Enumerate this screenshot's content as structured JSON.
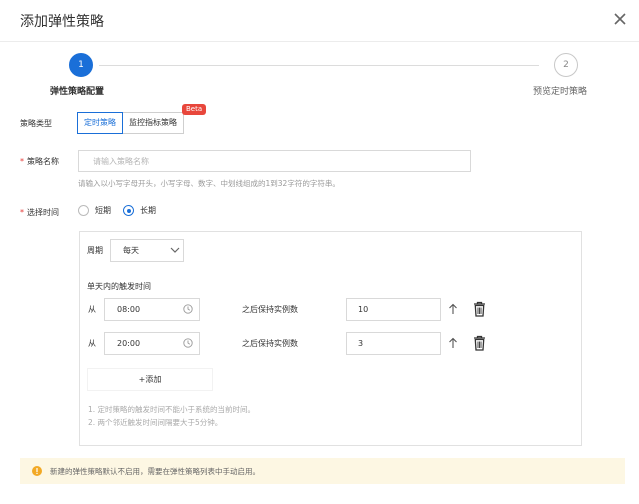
{
  "dialog": {
    "title": "添加弹性策略"
  },
  "steps": [
    {
      "number": "1",
      "label": "弹性策略配置",
      "status": "active"
    },
    {
      "number": "2",
      "label": "预览定时策略",
      "status": "pending"
    }
  ],
  "policy_type": {
    "label": "策略类型",
    "options": [
      {
        "label": "定时策略",
        "selected": true
      },
      {
        "label": "监控指标策略",
        "selected": false
      }
    ],
    "badge": "Beta"
  },
  "policy_name": {
    "label": "策略名称",
    "placeholder": "请输入策略名称",
    "value": "",
    "hint": "请输入以小写字母开头，小写字母、数字、中划线组成的1到32字符的字符串。"
  },
  "select_time": {
    "label": "选择时间",
    "options": [
      {
        "label": "短期",
        "checked": false
      },
      {
        "label": "长期",
        "checked": true
      }
    ]
  },
  "schedule": {
    "period_label": "周期",
    "period_value": "每天",
    "trigger_section_label": "单天内的触发时间",
    "rows": [
      {
        "from_label": "从",
        "time": "08:00",
        "keep_label": "之后保持实例数",
        "count": "10"
      },
      {
        "from_label": "从",
        "time": "20:00",
        "keep_label": "之后保持实例数",
        "count": "3"
      }
    ],
    "add_label": "+添加",
    "notes": [
      "1. 定时策略的触发时间不能小于系统的当前时间。",
      "2. 两个邻近触发时间间隔要大于5分钟。"
    ]
  },
  "alert": {
    "text": "新建的弹性策略默认不启用，需要在弹性策略列表中手动启用。"
  },
  "colors": {
    "primary": "#1a6fd8",
    "required": "#e53935",
    "badge": "#e8473c",
    "alert_bg": "#fdf7e3",
    "alert_icon": "#f2a925"
  },
  "icons": {
    "close": "close-icon",
    "clock": "clock-icon",
    "chevron": "chevron-down-icon",
    "move_up": "arrow-up-icon",
    "delete": "trash-icon",
    "warning": "warning-icon"
  }
}
